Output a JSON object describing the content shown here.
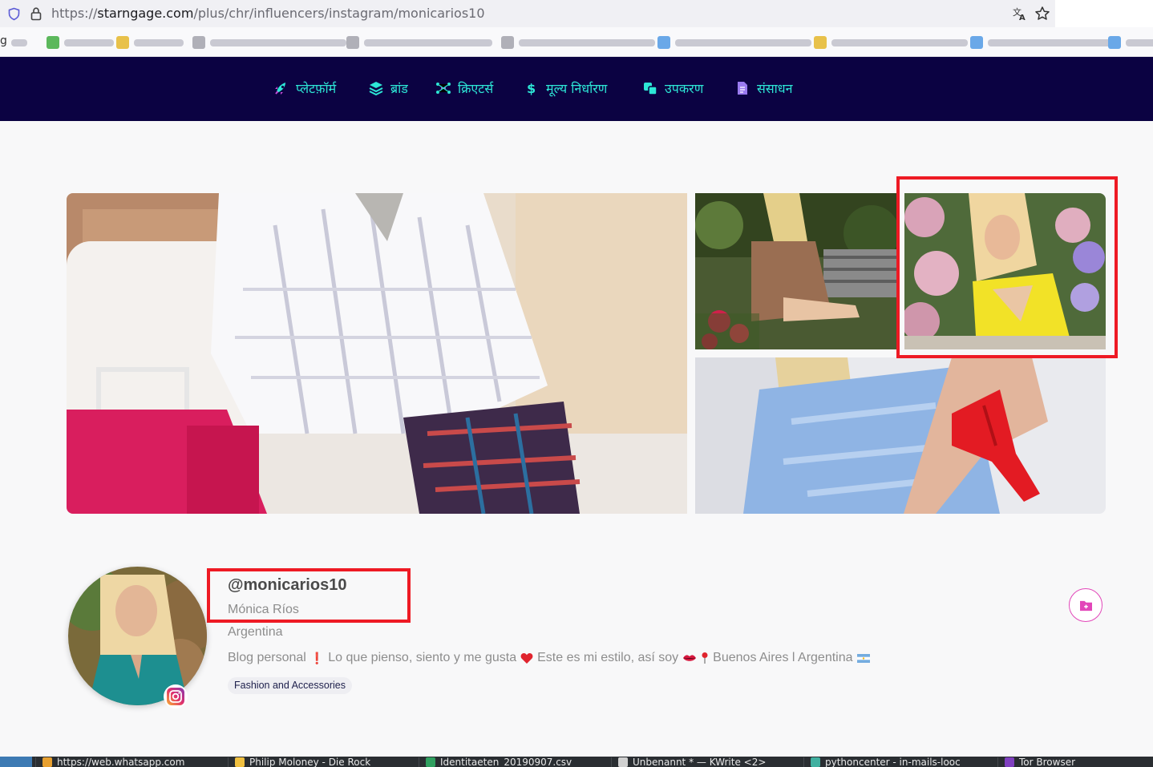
{
  "browser": {
    "url_prefix": "https://",
    "url_host": "starngage.com",
    "url_path": "/plus/chr/influencers/instagram/monicarios10"
  },
  "bookmarks": {
    "first_label": "g"
  },
  "nav": {
    "items": [
      {
        "label": "प्लेटफ़ॉर्म",
        "icon": "rocket-icon"
      },
      {
        "label": "ब्रांड",
        "icon": "layers-icon"
      },
      {
        "label": "क्रिएटर्स",
        "icon": "network-icon"
      },
      {
        "label": "मूल्य निर्धारण",
        "icon": "dollar-icon"
      },
      {
        "label": "उपकरण",
        "icon": "tools-icon"
      },
      {
        "label": "संसाधन",
        "icon": "document-icon"
      }
    ],
    "accent_color": "#2de7d6",
    "background_color": "#0b0242"
  },
  "profile": {
    "handle": "@monicarios10",
    "full_name": "Mónica Ríos",
    "country": "Argentina",
    "bio": {
      "part1": "Blog personal",
      "part2": "Lo que pienso, siento y me gusta",
      "part3": "Este es mi estilo, así soy",
      "part4": "Buenos Aires l Argentina"
    },
    "category": "Fashion and Accessories",
    "platform_icon": "instagram-icon"
  },
  "highlight_color": "#ee1a24",
  "taskbar": {
    "tasks": [
      "https://web.whatsapp.com",
      "Philip Moloney - Die Rock",
      "Identitaeten_20190907.csv",
      "Unbenannt * — KWrite <2>",
      "pythoncenter - in-mails-looc",
      "Tor Browser"
    ]
  }
}
